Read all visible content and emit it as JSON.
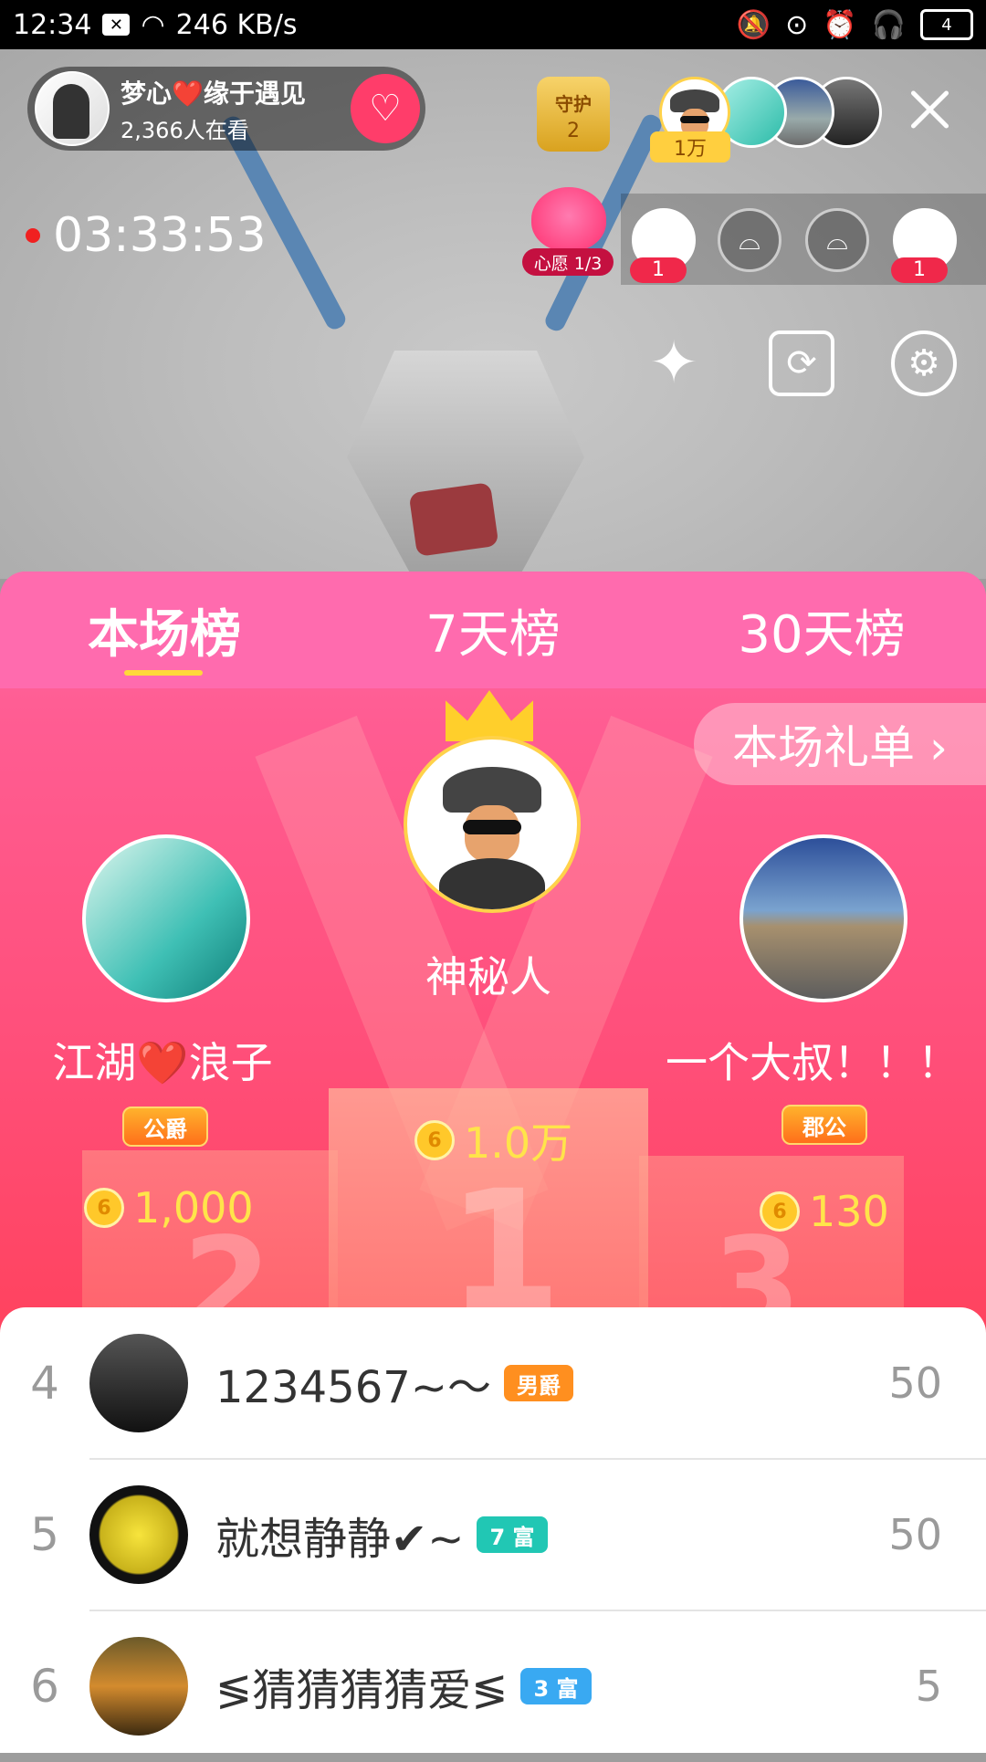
{
  "status_bar": {
    "time": "12:34",
    "net_speed": "246 KB/s",
    "battery": "4"
  },
  "host": {
    "name": "梦心❤️缘于遇见",
    "viewers": "2,366人在看"
  },
  "guard": {
    "label": "守护",
    "count": "2"
  },
  "viewer_badge": "1万",
  "timer": "03:33:53",
  "wish": {
    "label": "心愿 1/3"
  },
  "seats": [
    {
      "count": "1"
    },
    {
      "count": "1"
    }
  ],
  "icons": {
    "follow": "heart-plus-icon",
    "close": "close-icon",
    "beauty": "magic-wand-icon",
    "camera_switch": "camera-switch-icon",
    "settings": "gear-icon",
    "seat_empty": "sofa-icon"
  },
  "tabs": [
    {
      "label": "本场榜",
      "active": true
    },
    {
      "label": "7天榜",
      "active": false
    },
    {
      "label": "30天榜",
      "active": false
    }
  ],
  "gift_list_button": "本场礼单 ›",
  "podium": {
    "first": {
      "name": "神秘人",
      "amount": "1.0万"
    },
    "second": {
      "name": "江湖❤️浪子",
      "badge": "公爵",
      "amount": "1,000"
    },
    "third": {
      "name": "一个大叔！！！",
      "badge": "郡公",
      "amount": "130"
    }
  },
  "list": [
    {
      "rank": "4",
      "name": "1234567~〜",
      "badge": "男爵",
      "badge_color": "#ff8f1f",
      "value": "50"
    },
    {
      "rank": "5",
      "name": "就想静静✔~",
      "badge": "7 富",
      "badge_color": "#21c7b4",
      "value": "50"
    },
    {
      "rank": "6",
      "name": "≶猜猜猜猜爱≶",
      "badge": "3 富",
      "badge_color": "#39a9f2",
      "value": "5"
    }
  ],
  "colors": {
    "accent_pink": "#ff5d93",
    "gold": "#ffe44a",
    "live_red": "#f02020"
  }
}
